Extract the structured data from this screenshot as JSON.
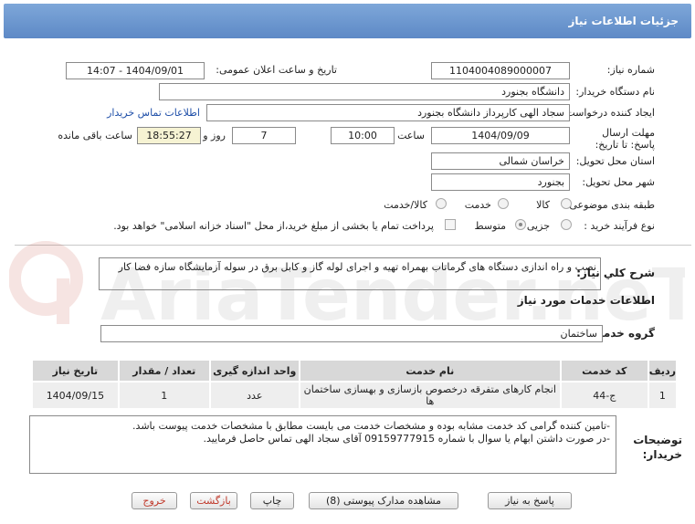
{
  "header": {
    "title": "جزئیات اطلاعات نیاز"
  },
  "need_number": {
    "label": "شماره نیاز:",
    "value": "1104004089000007"
  },
  "announce": {
    "label": "تاریخ و ساعت اعلان عمومی:",
    "value": "1404/09/01 - 14:07"
  },
  "buyer_org": {
    "label": "نام دستگاه خریدار:",
    "value": "دانشگاه بجنورد"
  },
  "creator": {
    "label": "ایجاد کننده درخواست:",
    "value": "سجاد الهی کارپرداز دانشگاه بجنورد",
    "contact_link": "اطلاعات تماس خریدار"
  },
  "deadline": {
    "label": "مهلت ارسال پاسخ: تا تاریخ:",
    "date": "1404/09/09",
    "time_label": "ساعت",
    "time": "10:00",
    "days": "7",
    "days_label": "روز و",
    "remaining": "18:55:27",
    "remaining_label": "ساعت باقی مانده"
  },
  "province": {
    "label": "استان محل تحویل:",
    "value": "خراسان شمالی"
  },
  "city": {
    "label": "شهر محل تحویل:",
    "value": "بجنورد"
  },
  "category": {
    "label": "طبقه بندی موضوعی:",
    "options": [
      "کالا",
      "خدمت",
      "کالا/خدمت"
    ]
  },
  "purchase_type": {
    "label": "نوع فرآیند خرید :",
    "options": [
      "جزیی",
      "متوسط"
    ],
    "payment_note": "پرداخت تمام یا بخشی از مبلغ خرید،از محل \"اسناد خزانه اسلامی\" خواهد بود."
  },
  "summary": {
    "label": "شرح کلي نياز:",
    "value": "نصب و راه اندازی دستگاه های گرماتاب  بهمراه تهیه و اجرای لوله گاز و کابل برق در سوله آزمایشگاه سازه فضا کار"
  },
  "services_title": "اطلاعات خدمات مورد نياز",
  "service_group": {
    "label": "گروه خدمت:",
    "value": "ساختمان"
  },
  "table": {
    "headers": [
      "ردیف",
      "کد خدمت",
      "نام خدمت",
      "واحد اندازه گیری",
      "تعداد / مقدار",
      "تاریخ نیاز"
    ],
    "rows": [
      [
        "1",
        "ج-44",
        "انجام کارهای متفرقه درخصوص بازسازی و بهسازی ساختمان ها",
        "عدد",
        "1",
        "1404/09/15"
      ]
    ]
  },
  "buyer_notes": {
    "label": "توضيحات خريدار:",
    "lines": [
      "-تامین کننده گرامی کد خدمت مشابه بوده و مشخصات خدمت می بایست مطابق با مشخصات خدمت پیوست باشد.",
      "-در صورت داشتن ابهام یا سوال با شماره 09159777915 آقای سجاد الهی تماس حاصل فرمایید."
    ]
  },
  "buttons": {
    "respond": "پاسخ به نیاز",
    "attachments": "مشاهده مدارک پیوستی (8)",
    "print": "چاپ",
    "back": "بازگشت",
    "exit": "خروج"
  },
  "watermark_text": "AriaTender.neT"
}
